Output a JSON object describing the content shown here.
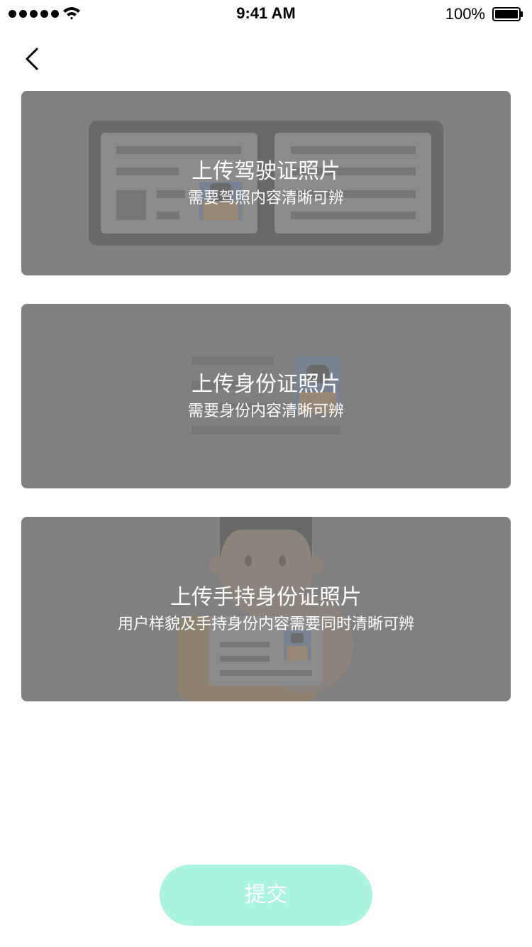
{
  "status_bar": {
    "time": "9:41 AM",
    "battery": "100%"
  },
  "nav": {
    "back_icon": "chevron-left-icon"
  },
  "cards": [
    {
      "title": "上传驾驶证照片",
      "subtitle": "需要驾照内容清晰可辨"
    },
    {
      "title": "上传身份证照片",
      "subtitle": "需要身份内容清晰可辨"
    },
    {
      "title": "上传手持身份证照片",
      "subtitle": "用户样貌及手持身份内容需要同时清晰可辨"
    }
  ],
  "submit": {
    "label": "提交"
  },
  "colors": {
    "card_bg": "#808080",
    "submit_bg": "#a9f3df",
    "submit_text": "#ffffff"
  }
}
